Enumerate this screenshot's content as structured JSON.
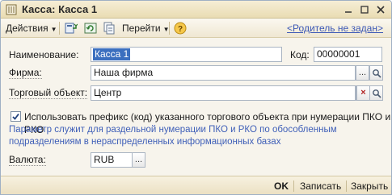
{
  "window": {
    "title": "Касса: Касса 1"
  },
  "toolbar": {
    "actions_label": "Действия",
    "goto_label": "Перейти",
    "parent_link": "<Родитель не задан>",
    "help_label": "?"
  },
  "form": {
    "name_label": "Наименование:",
    "name_value": "Касса 1",
    "code_label": "Код:",
    "code_value": "00000001",
    "firm_label": "Фирма:",
    "firm_value": "Наша фирма",
    "trade_label": "Торговый объект:",
    "trade_value": "Центр",
    "prefix_checkbox_label": "Использовать префикс (код) указанного торгового объекта при нумерации ПКО и РКО",
    "prefix_checked": true,
    "hint_line1": "Параметр служит для раздельной нумерации ПКО и РКО по обособленным",
    "hint_line2": "подразделениям в нераспределенных информационных базах",
    "currency_label": "Валюта:",
    "currency_value": "RUB"
  },
  "buttons": {
    "select": "...",
    "clear": "×",
    "open": "🔍"
  },
  "footer": {
    "ok_label": "OK",
    "save_label": "Записать",
    "close_label": "Закрыть"
  },
  "colors": {
    "link": "#3c58b6",
    "hint": "#3f5fb8",
    "selection": "#3b6fbf"
  }
}
